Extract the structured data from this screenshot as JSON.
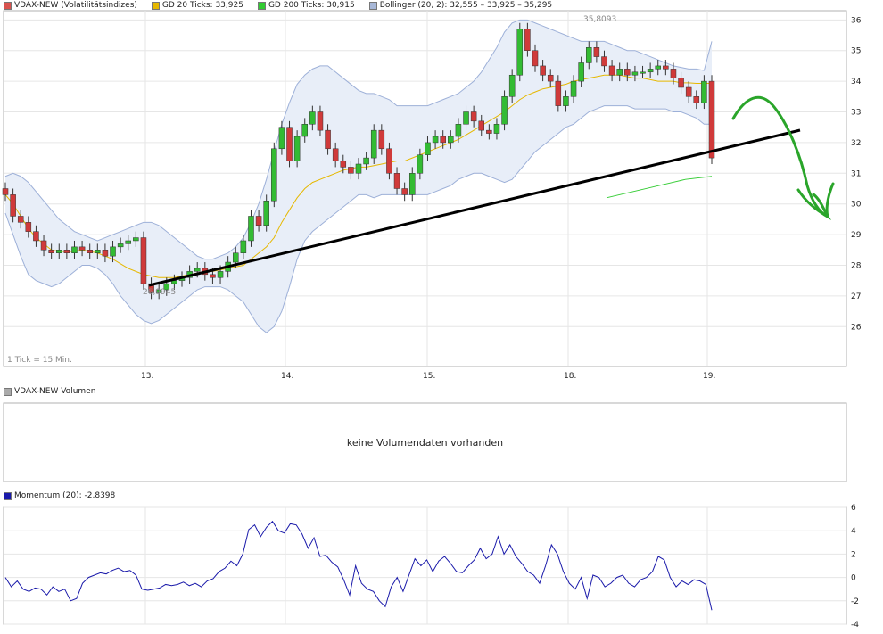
{
  "legend_top": [
    {
      "label": "VDAX-NEW (Volatilitätsindizes)",
      "color": "#d9534f"
    },
    {
      "label": "GD 20 Ticks: 33,925",
      "color": "#e6b800"
    },
    {
      "label": "GD 200 Ticks: 30,915",
      "color": "#33cc33"
    },
    {
      "label": "Bollinger (20, 2): 32,555 – 33,925 – 35,295",
      "color": "#a8b8d8"
    }
  ],
  "legend_volume": {
    "label": "VDAX-NEW Volumen",
    "color": "#aaaaaa"
  },
  "volume_message": "keine Volumendaten vorhanden",
  "legend_momentum": {
    "label": "Momentum (20): -2,8398",
    "color": "#1a1aaa"
  },
  "tick_note": "1 Tick = 15 Min.",
  "annotations": {
    "high": "35,8093",
    "low": "26,9945"
  },
  "chart_data": [
    {
      "type": "line",
      "name": "VDAX-NEW price chart (15-min candlesticks)",
      "y_ticks": [
        26,
        27,
        28,
        29,
        30,
        31,
        32,
        33,
        34,
        35,
        36
      ],
      "x_ticks": [
        "13.",
        "14.",
        "15.",
        "18.",
        "19."
      ],
      "ylim": [
        24.7,
        36.3
      ],
      "grid": true,
      "series": [
        {
          "name": "VDAX-NEW",
          "values": [
            30.3,
            29.6,
            29.4,
            29.1,
            28.8,
            28.5,
            28.4,
            28.5,
            28.4,
            28.6,
            28.5,
            28.4,
            28.5,
            28.3,
            28.6,
            28.7,
            28.8,
            28.9,
            27.4,
            27.1,
            27.2,
            27.4,
            27.5,
            27.6,
            27.8,
            27.9,
            27.7,
            27.6,
            27.8,
            28.1,
            28.4,
            28.8,
            29.6,
            29.3,
            30.1,
            31.8,
            32.5,
            31.4,
            32.2,
            32.6,
            33.0,
            32.4,
            31.8,
            31.4,
            31.2,
            31.0,
            31.3,
            31.5,
            32.4,
            31.8,
            31.0,
            30.5,
            30.3,
            31.0,
            31.6,
            32.0,
            32.2,
            32.0,
            32.2,
            32.6,
            33.0,
            32.7,
            32.4,
            32.3,
            32.6,
            33.5,
            34.2,
            35.7,
            35.0,
            34.5,
            34.2,
            34.0,
            33.2,
            33.5,
            34.0,
            34.6,
            35.1,
            34.8,
            34.5,
            34.2,
            34.4,
            34.2,
            34.3,
            34.3,
            34.4,
            34.5,
            34.4,
            34.1,
            33.8,
            33.5,
            33.3,
            34.0,
            31.5
          ]
        },
        {
          "name": "GD 20 Ticks",
          "values": [
            30.3,
            30.0,
            29.6,
            29.2,
            28.9,
            28.7,
            28.5,
            28.45,
            28.45,
            28.45,
            28.5,
            28.45,
            28.4,
            28.3,
            28.2,
            28.05,
            27.9,
            27.8,
            27.7,
            27.65,
            27.6,
            27.6,
            27.6,
            27.65,
            27.7,
            27.75,
            27.8,
            27.8,
            27.85,
            27.9,
            27.95,
            28.0,
            28.2,
            28.4,
            28.6,
            28.9,
            29.4,
            29.8,
            30.2,
            30.5,
            30.7,
            30.8,
            30.9,
            31.0,
            31.1,
            31.15,
            31.2,
            31.2,
            31.25,
            31.3,
            31.35,
            31.4,
            31.4,
            31.5,
            31.6,
            31.7,
            31.8,
            31.9,
            32.0,
            32.1,
            32.25,
            32.4,
            32.55,
            32.7,
            32.85,
            33.0,
            33.2,
            33.4,
            33.55,
            33.65,
            33.75,
            33.8,
            33.85,
            33.9,
            34.0,
            34.05,
            34.1,
            34.15,
            34.2,
            34.2,
            34.2,
            34.15,
            34.1,
            34.1,
            34.05,
            34.0,
            34.0,
            34.0,
            33.95,
            33.95,
            33.93,
            33.93,
            33.93
          ]
        },
        {
          "name": "Bollinger upper",
          "values": [
            30.9,
            31.0,
            30.9,
            30.7,
            30.4,
            30.1,
            29.8,
            29.5,
            29.3,
            29.1,
            29.0,
            28.9,
            28.8,
            28.9,
            29.0,
            29.1,
            29.2,
            29.3,
            29.4,
            29.4,
            29.3,
            29.1,
            28.9,
            28.7,
            28.5,
            28.3,
            28.2,
            28.2,
            28.3,
            28.4,
            28.6,
            28.9,
            29.4,
            30.0,
            30.8,
            31.7,
            32.6,
            33.3,
            33.9,
            34.2,
            34.4,
            34.5,
            34.5,
            34.3,
            34.1,
            33.9,
            33.7,
            33.6,
            33.6,
            33.5,
            33.4,
            33.2,
            33.2,
            33.2,
            33.2,
            33.2,
            33.3,
            33.4,
            33.5,
            33.6,
            33.8,
            34.0,
            34.3,
            34.7,
            35.1,
            35.6,
            35.9,
            36.0,
            36.0,
            35.9,
            35.8,
            35.7,
            35.6,
            35.5,
            35.4,
            35.3,
            35.3,
            35.3,
            35.3,
            35.2,
            35.1,
            35.0,
            35.0,
            34.9,
            34.8,
            34.7,
            34.6,
            34.5,
            34.45,
            34.4,
            34.4,
            34.35,
            35.3
          ]
        },
        {
          "name": "Bollinger lower",
          "values": [
            29.7,
            29.0,
            28.3,
            27.7,
            27.5,
            27.4,
            27.3,
            27.4,
            27.6,
            27.8,
            28.0,
            28.0,
            27.9,
            27.7,
            27.4,
            27.0,
            26.7,
            26.4,
            26.2,
            26.1,
            26.2,
            26.4,
            26.6,
            26.8,
            27.0,
            27.2,
            27.3,
            27.3,
            27.3,
            27.2,
            27.0,
            26.8,
            26.4,
            26.0,
            25.8,
            26.0,
            26.5,
            27.3,
            28.2,
            28.8,
            29.1,
            29.3,
            29.5,
            29.7,
            29.9,
            30.1,
            30.3,
            30.3,
            30.2,
            30.3,
            30.3,
            30.3,
            30.3,
            30.3,
            30.3,
            30.3,
            30.4,
            30.5,
            30.6,
            30.8,
            30.9,
            31.0,
            31.0,
            30.9,
            30.8,
            30.7,
            30.8,
            31.1,
            31.4,
            31.7,
            31.9,
            32.1,
            32.3,
            32.5,
            32.6,
            32.8,
            33.0,
            33.1,
            33.2,
            33.2,
            33.2,
            33.2,
            33.1,
            33.1,
            33.1,
            33.1,
            33.1,
            33.0,
            33.0,
            32.9,
            32.8,
            32.6,
            32.6
          ]
        },
        {
          "name": "GD 200 Ticks",
          "values": [
            30.2,
            30.4,
            30.6,
            30.8,
            30.9
          ]
        }
      ]
    },
    {
      "type": "line",
      "name": "Momentum (20)",
      "y_ticks": [
        -4,
        -2,
        0,
        2,
        4,
        6
      ],
      "ylim": [
        -4,
        6
      ],
      "grid": true,
      "series": [
        {
          "name": "Momentum (20)",
          "values": [
            0.0,
            -0.8,
            -0.3,
            -1.0,
            -1.2,
            -0.9,
            -1.0,
            -1.5,
            -0.8,
            -1.2,
            -1.0,
            -2.0,
            -1.8,
            -0.5,
            0.0,
            0.2,
            0.4,
            0.3,
            0.6,
            0.8,
            0.5,
            0.6,
            0.2,
            -1.0,
            -1.1,
            -1.0,
            -0.9,
            -0.6,
            -0.7,
            -0.6,
            -0.4,
            -0.7,
            -0.5,
            -0.8,
            -0.3,
            -0.1,
            0.5,
            0.8,
            1.4,
            1.0,
            2.0,
            4.1,
            4.5,
            3.5,
            4.3,
            4.8,
            4.0,
            3.8,
            4.6,
            4.5,
            3.7,
            2.5,
            3.4,
            1.8,
            1.9,
            1.3,
            0.9,
            -0.2,
            -1.5,
            1.0,
            -0.5,
            -1.0,
            -1.2,
            -2.0,
            -2.5,
            -0.8,
            0.0,
            -1.2,
            0.2,
            1.6,
            1.0,
            1.5,
            0.5,
            1.4,
            1.8,
            1.2,
            0.5,
            0.4,
            1.0,
            1.5,
            2.5,
            1.6,
            2.0,
            3.5,
            2.0,
            2.8,
            1.8,
            1.2,
            0.5,
            0.2,
            -0.5,
            1.0,
            2.8,
            2.0,
            0.5,
            -0.5,
            -1.0,
            0.0,
            -1.8,
            0.2,
            0.0,
            -0.8,
            -0.5,
            0.0,
            0.2,
            -0.5,
            -0.8,
            -0.2,
            0.0,
            0.5,
            1.8,
            1.5,
            0.0,
            -0.8,
            -0.3,
            -0.6,
            -0.2,
            -0.3,
            -0.6,
            -2.8
          ]
        }
      ]
    }
  ]
}
